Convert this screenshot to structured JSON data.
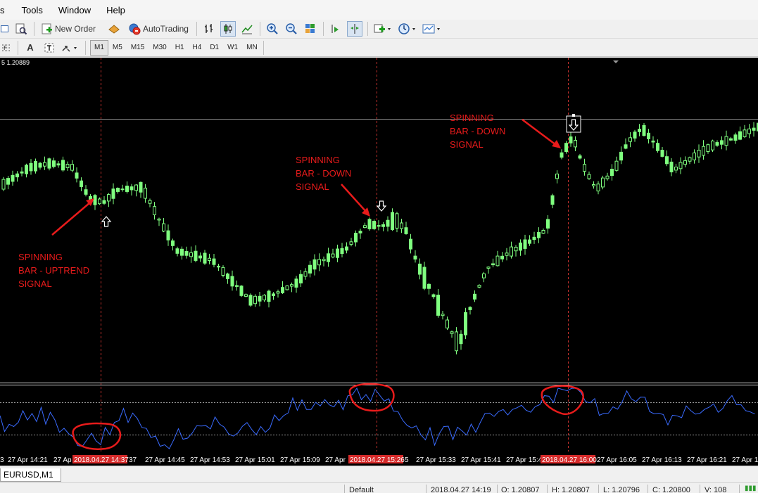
{
  "menu": {
    "items": [
      "s",
      "Tools",
      "Window",
      "Help"
    ]
  },
  "toolbar": {
    "new_order_label": "New Order",
    "autotrading_label": "AutoTrading",
    "timeframes": [
      "M1",
      "M5",
      "M15",
      "M30",
      "H1",
      "H4",
      "D1",
      "W1",
      "MN"
    ],
    "active_timeframe": "M1",
    "text_tool_label": "A"
  },
  "chart": {
    "price_info": "5 1.20889",
    "annotations": [
      {
        "lines": [
          "SPINNING",
          "BAR - UPTREND",
          "SIGNAL"
        ]
      },
      {
        "lines": [
          "SPINNING",
          "BAR - DOWN",
          "SIGNAL"
        ]
      },
      {
        "lines": [
          "SPINNING",
          "BAR - DOWN",
          "SIGNAL"
        ]
      }
    ],
    "time_labels": [
      "3",
      "27 Apr 14:21",
      "27 Ap",
      "37",
      "27 Apr 14:45",
      "27 Apr 14:53",
      "27 Apr 15:01",
      "27 Apr 15:09",
      "27 Apr",
      "5",
      "27 Apr 15:33",
      "27 Apr 15:41",
      "27 Apr 15:4",
      "27 Apr 16:05",
      "27 Apr 16:13",
      "27 Apr 16:21",
      "27 Apr 1"
    ],
    "highlighted_times": [
      "2018.04.27 14:37",
      "2018.04.27 15:26",
      "2018.04.27 16:00"
    ],
    "colors": {
      "candle": "#7fff7f",
      "indicator": "#3a6bff",
      "annotation": "#e81b1b",
      "vline": "#c0302c",
      "highlight_bg": "#d62a2a"
    }
  },
  "tabs": {
    "active": "EURUSD,M1"
  },
  "status": {
    "profile": "Default",
    "datetime": "2018.04.27 14:19",
    "open": "O: 1.20807",
    "high": "H: 1.20807",
    "low": "L: 1.20796",
    "close": "C: 1.20800",
    "volume": "V: 108"
  }
}
